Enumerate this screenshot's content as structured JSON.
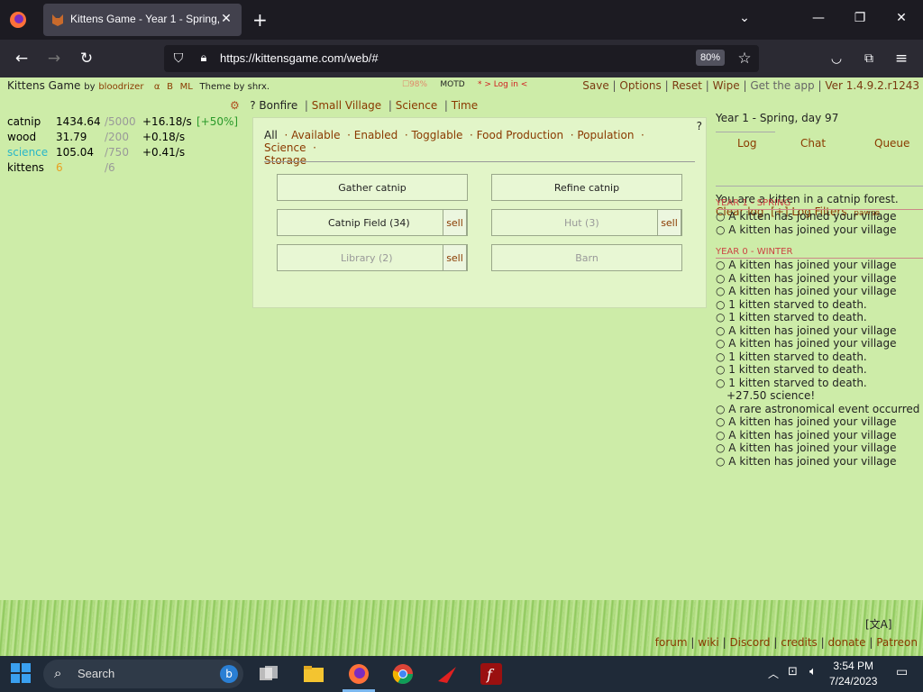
{
  "browser": {
    "tab_title": "Kittens Game - Year 1 - Spring, d",
    "url": "https://kittensgame.com/web/#",
    "zoom": "80%"
  },
  "game": {
    "title": "Kittens Game",
    "by": "by",
    "author": "bloodrizer",
    "links": [
      "α",
      "B",
      "ML"
    ],
    "theme": "Theme by shrx.",
    "heat": "98%",
    "motd": "MOTD",
    "login": "* > Log in <",
    "header_menu": [
      "Save",
      "Options",
      "Reset",
      "Wipe",
      "Get the app",
      "Ver 1.4.9.2.r1243"
    ],
    "main_tabs": [
      "Bonfire",
      "Small Village",
      "Science",
      "Time"
    ],
    "resources": [
      {
        "name": "catnip",
        "value": "1434.64",
        "max": "/5000",
        "rate": "+16.18/s",
        "bonus": "[+50%]",
        "color": "#222"
      },
      {
        "name": "wood",
        "value": "31.79",
        "max": "/200",
        "rate": "+0.18/s",
        "bonus": "",
        "color": "#222"
      },
      {
        "name": "science",
        "value": "105.04",
        "max": "/750",
        "rate": "+0.41/s",
        "bonus": "",
        "color": "#29b6c8"
      },
      {
        "name": "kittens",
        "value": "6",
        "max": "/6",
        "rate": "",
        "bonus": "",
        "color": "#222"
      }
    ],
    "filters": [
      "All",
      "Available",
      "Enabled",
      "Togglable",
      "Food Production",
      "Population",
      "Science",
      "Storage"
    ],
    "buttons": {
      "gather": "Gather catnip",
      "refine": "Refine catnip",
      "field": "Catnip Field (34)",
      "hut": "Hut (3)",
      "library": "Library (2)",
      "barn": "Barn",
      "sell": "sell"
    },
    "date": "Year 1 - Spring, day 97",
    "log_tabs": [
      "Log",
      "Chat",
      "Queue"
    ],
    "log_intro": "You are a kitten in a catnip forest.",
    "clear_log": "Clear log",
    "log_filters": "[+] Log Filters",
    "pawse": "pawse",
    "log_spring_header": "YEAR 1 - SPRING",
    "log_spring": [
      "A kitten has joined your village",
      "A kitten has joined your village"
    ],
    "log_winter_header": "YEAR 0 - WINTER",
    "log_winter": [
      "A kitten has joined your village",
      "A kitten has joined your village",
      "A kitten has joined your village",
      "1 kitten starved to death.",
      "1 kitten starved to death.",
      "A kitten has joined your village",
      "A kitten has joined your village",
      "1 kitten starved to death.",
      "1 kitten starved to death.",
      "1 kitten starved to death.",
      "+27.50 science!",
      "A rare astronomical event occurred in",
      "A kitten has joined your village",
      "A kitten has joined your village",
      "A kitten has joined your village",
      "A kitten has joined your village"
    ],
    "footer": [
      "forum",
      "wiki",
      "Discord",
      "credits",
      "donate",
      "Patreon"
    ],
    "lang": "[文A]"
  },
  "taskbar": {
    "search": "Search",
    "time": "3:54 PM",
    "date": "7/24/2023"
  }
}
